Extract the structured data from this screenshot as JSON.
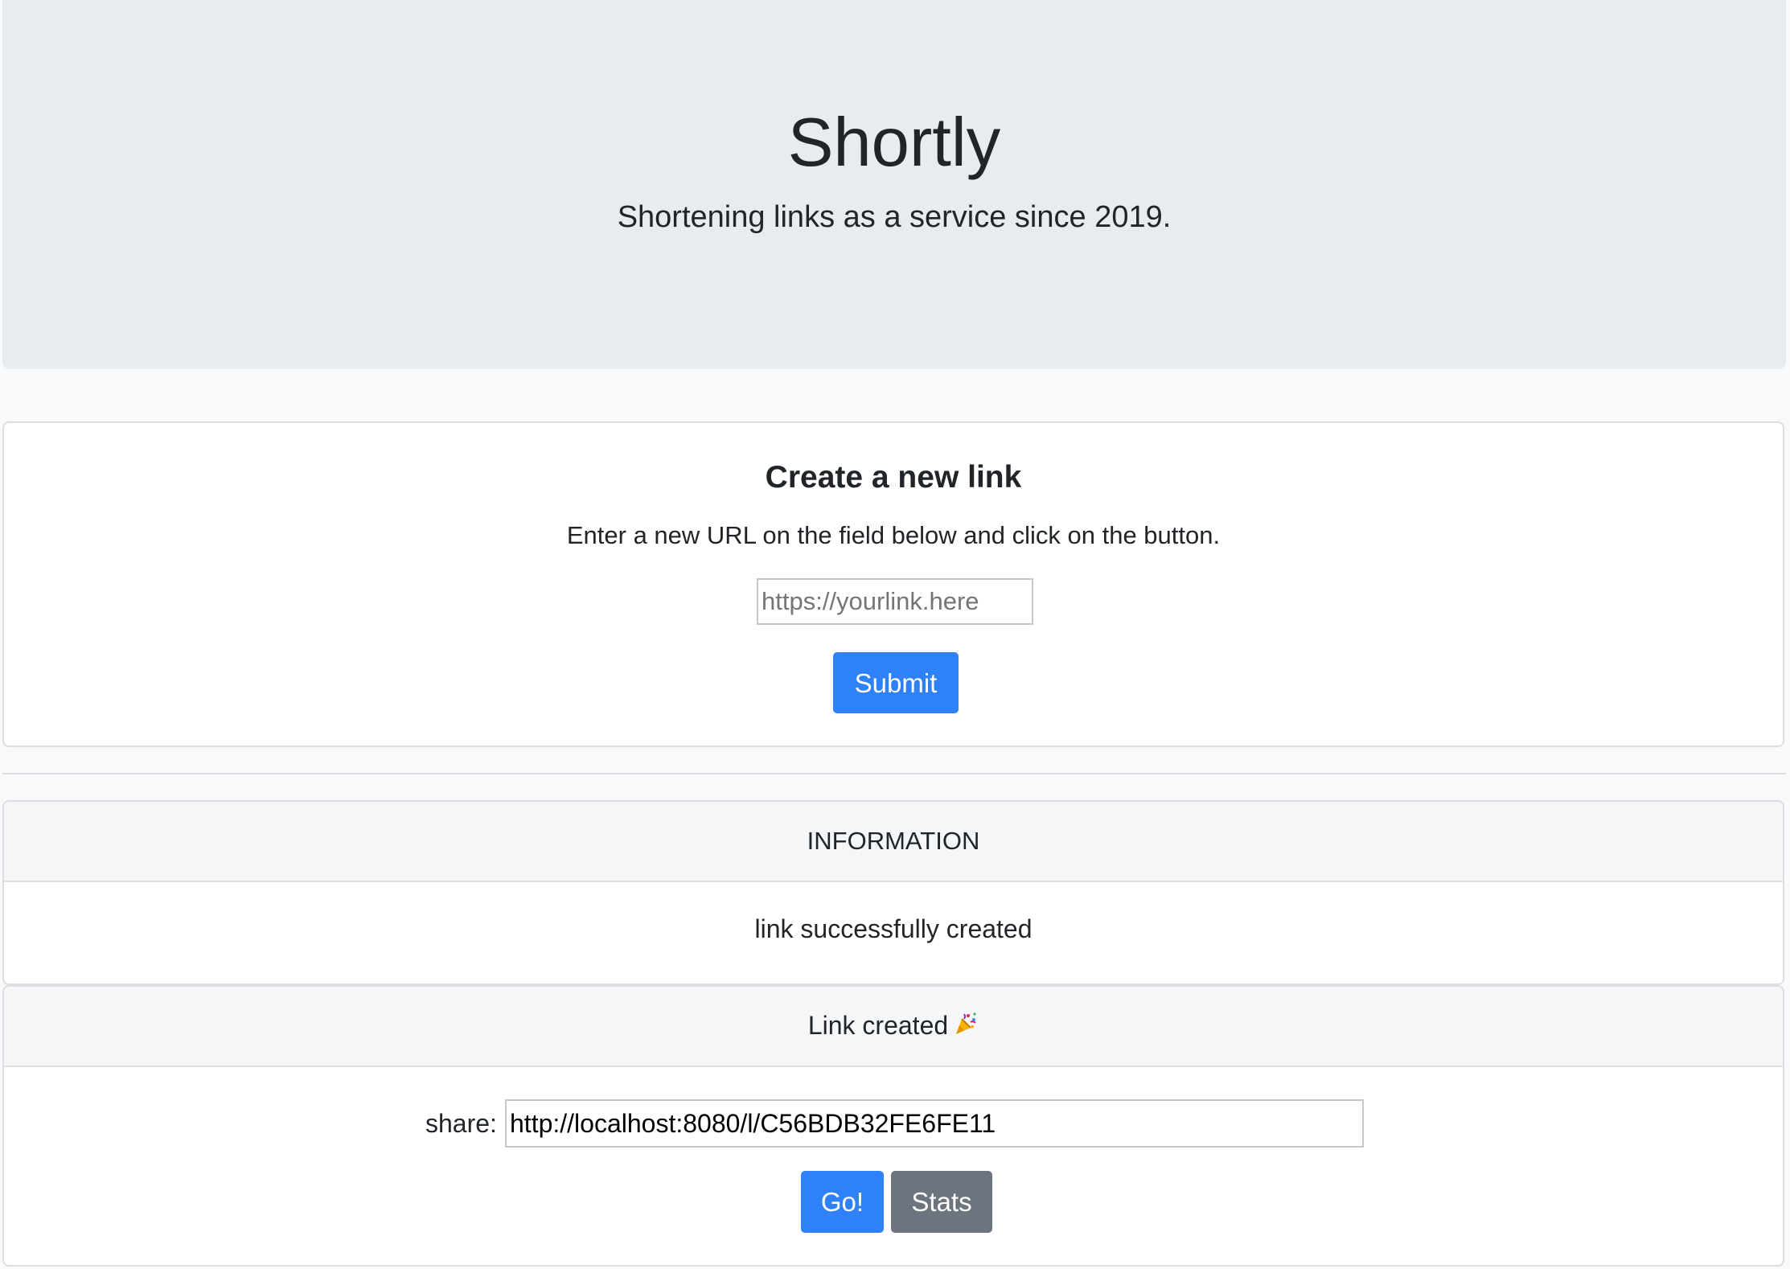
{
  "hero": {
    "title": "Shortly",
    "tagline": "Shortening links as a service since 2019."
  },
  "create": {
    "heading": "Create a new link",
    "instructions": "Enter a new URL on the field below and click on the button.",
    "input_placeholder": "https://yourlink.here",
    "input_value": "",
    "submit_label": "Submit"
  },
  "info": {
    "header": "INFORMATION",
    "message": "link successfully created"
  },
  "link": {
    "header": "Link created",
    "header_icon": "party-popper-icon",
    "share_label": "share:",
    "share_url": "http://localhost:8080/l/C56BDB32FE6FE11",
    "go_label": "Go!",
    "stats_label": "Stats"
  },
  "colors": {
    "primary": "#2f81f7",
    "secondary": "#6c757d",
    "jumbotron_bg": "#e9ecef",
    "page_bg": "#f8f9fa",
    "text": "#212529"
  }
}
